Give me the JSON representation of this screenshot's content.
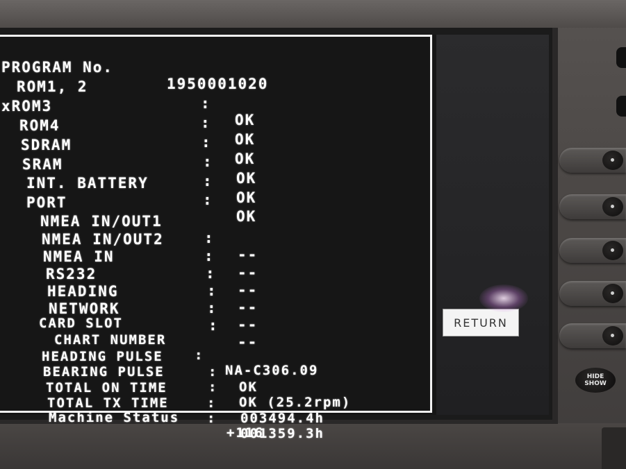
{
  "program": {
    "label": "PROGRAM No.",
    "number": "1950001020"
  },
  "rows": [
    {
      "label": "ROM1, 2",
      "sep": ":",
      "value": "OK"
    },
    {
      "label": "xROM3",
      "sep": ":",
      "value": "OK"
    },
    {
      "label": "ROM4",
      "sep": ":",
      "value": "OK"
    },
    {
      "label": "SDRAM",
      "sep": ":",
      "value": "OK"
    },
    {
      "label": "SRAM",
      "sep": ":",
      "value": "OK"
    },
    {
      "label": "INT. BATTERY",
      "sep": ":",
      "value": "OK"
    }
  ],
  "port": {
    "title": "PORT",
    "rows": [
      {
        "label": "NMEA IN/OUT1",
        "sep": ":",
        "value": "--"
      },
      {
        "label": "NMEA IN/OUT2",
        "sep": ":",
        "value": "--"
      },
      {
        "label": "NMEA IN",
        "sep": ":",
        "value": "--"
      },
      {
        "label": "RS232",
        "sep": ":",
        "value": "--"
      },
      {
        "label": "HEADING",
        "sep": ":",
        "value": "--"
      },
      {
        "label": "NETWORK",
        "sep": ":",
        "value": "--"
      }
    ]
  },
  "card_slot": {
    "title": "CARD SLOT",
    "chart_number": {
      "label": "CHART NUMBER",
      "sep": ":",
      "value": "NA-C306.09"
    }
  },
  "heading_pulse": {
    "label": "HEADING PULSE",
    "sep": ":",
    "value": "OK"
  },
  "bearing_pulse": {
    "label": "BEARING PULSE",
    "sep": ":",
    "value": "OK (25.2rpm)"
  },
  "total_on_time": {
    "label": "TOTAL ON TIME",
    "sep": ":",
    "value": "003494.4h"
  },
  "total_tx_time": {
    "label": "TOTAL TX TIME",
    "sep": ":",
    "value": "001359.3h"
  },
  "machine_status": {
    "label": "Machine Status",
    "value": "+116"
  },
  "return_button": "RETURN",
  "hide_show": {
    "line1": "HIDE",
    "line2": "SHOW"
  },
  "colors": {
    "screen_bg": "#161616",
    "text": "#ffffff",
    "bezel": "#4a4746"
  }
}
